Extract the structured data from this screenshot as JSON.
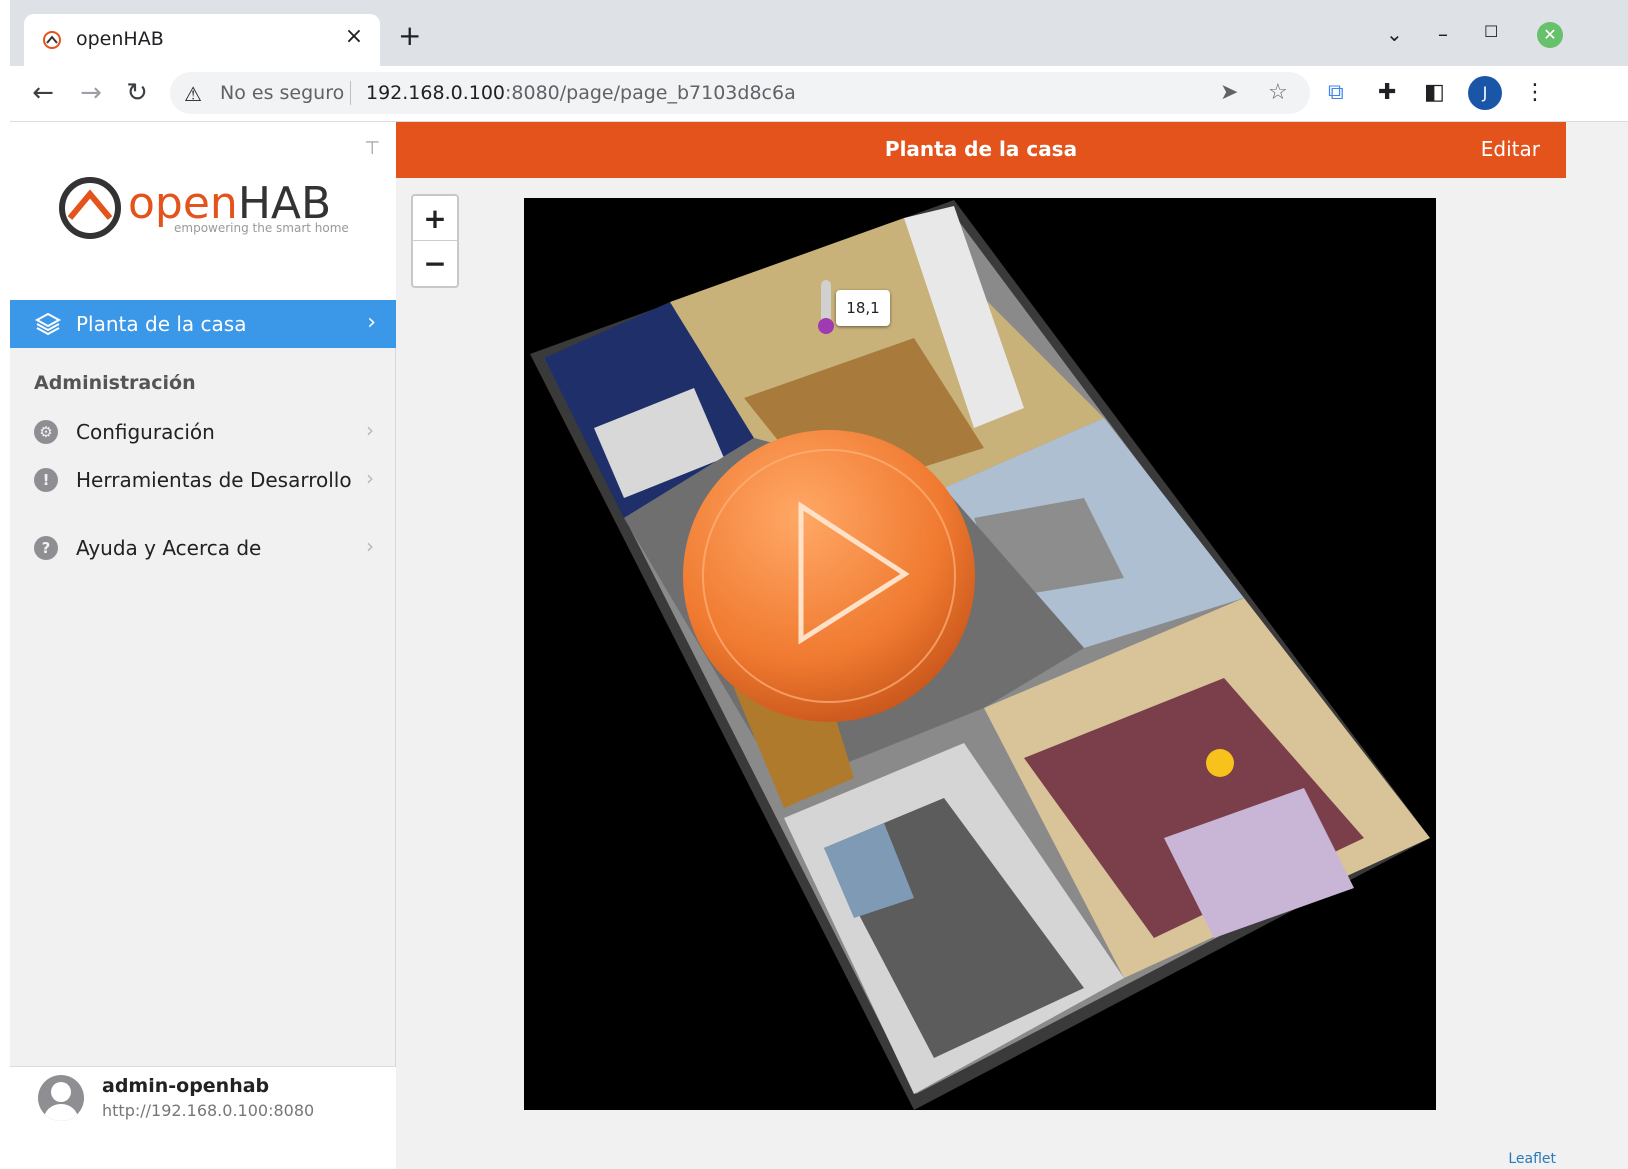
{
  "browser": {
    "tab_title": "openHAB",
    "tab_close": "×",
    "new_tab": "+",
    "not_secure": "No es seguro",
    "url_host": "192.168.0.100",
    "url_rest": ":8080/page/page_b7103d8c6a",
    "profile_initial": "J"
  },
  "sidebar": {
    "logo_text": "openHAB",
    "logo_tagline": "empowering the smart home",
    "active_item": "Planta de la casa",
    "section_title": "Administración",
    "items": [
      {
        "label": "Configuración",
        "icon": "gear-icon"
      },
      {
        "label": "Herramientas de Desarrollo",
        "icon": "shield-icon"
      },
      {
        "label": "Ayuda y Acerca de",
        "icon": "help-icon"
      }
    ],
    "user": {
      "name": "admin-openhab",
      "url": "http://192.168.0.100:8080"
    }
  },
  "page": {
    "title": "Planta de la casa",
    "edit_label": "Editar",
    "zoom_in": "+",
    "zoom_out": "−",
    "temperature_tooltip": "18,1",
    "attribution": "Leaflet"
  },
  "colors": {
    "navbar": "#e4531c",
    "active_nav": "#3b97e8",
    "play_button": "#f07a30"
  }
}
